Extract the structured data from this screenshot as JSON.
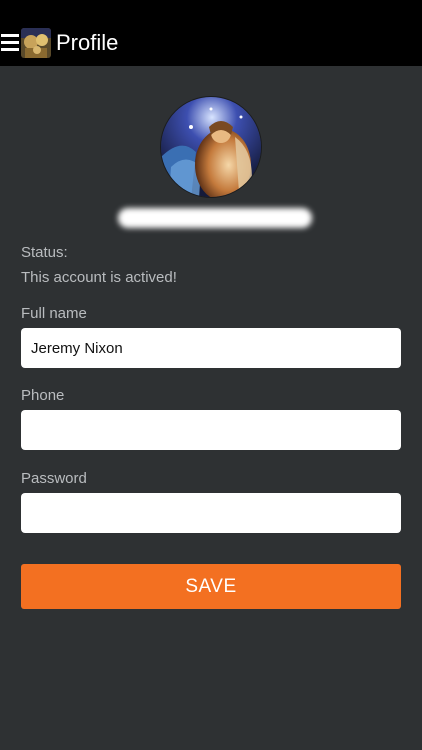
{
  "header": {
    "title": "Profile",
    "menu_icon": "hamburger-menu-icon",
    "logo": "app-logo"
  },
  "profile": {
    "avatar": "profile-avatar-image",
    "status_label": "Status:",
    "status_text": "This account is actived!"
  },
  "form": {
    "full_name_label": "Full name",
    "full_name_value": "Jeremy Nixon",
    "phone_label": "Phone",
    "phone_value": "",
    "password_label": "Password",
    "password_value": "",
    "save_label": "SAVE"
  },
  "colors": {
    "topbar": "#000000",
    "background": "#2e3133",
    "accent": "#f37021",
    "label_text": "#b9bcbf"
  }
}
